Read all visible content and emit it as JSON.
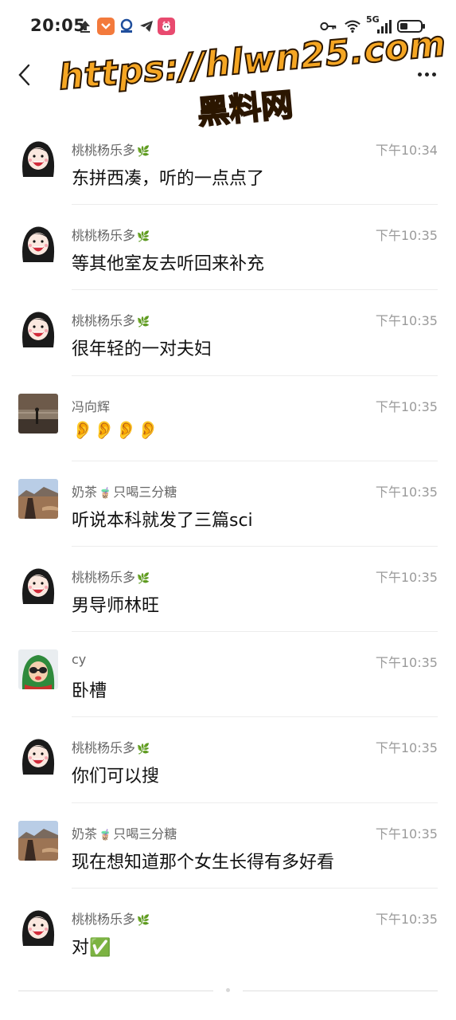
{
  "status_bar": {
    "time": "20:05",
    "network_label": "5G"
  },
  "nav": {
    "back_icon": "chevron-left-icon",
    "more_icon": "more-horizontal-icon"
  },
  "watermark": {
    "line1": "https://hlwn25.com",
    "line2": "黑料网"
  },
  "messages": [
    {
      "name": "桃桃杨乐多",
      "name_emoji": "🌿",
      "time": "下午10:34",
      "text": "东拼西凑，听的一点点了",
      "avatar": "cartoon-girl"
    },
    {
      "name": "桃桃杨乐多",
      "name_emoji": "🌿",
      "time": "下午10:35",
      "text": "等其他室友去听回来补充",
      "avatar": "cartoon-girl"
    },
    {
      "name": "桃桃杨乐多",
      "name_emoji": "🌿",
      "time": "下午10:35",
      "text": "很年轻的一对夫妇",
      "avatar": "cartoon-girl"
    },
    {
      "name": "冯向辉",
      "name_emoji": "",
      "time": "下午10:35",
      "text": "👂👂👂👂",
      "avatar": "beach-photo"
    },
    {
      "name": "奶茶",
      "name_emoji": "🧋",
      "name_suffix": "只喝三分糖",
      "time": "下午10:35",
      "text": "听说本科就发了三篇sci",
      "avatar": "landscape-photo"
    },
    {
      "name": "桃桃杨乐多",
      "name_emoji": "🌿",
      "time": "下午10:35",
      "text": "男导师林旺",
      "avatar": "cartoon-girl"
    },
    {
      "name": "cy",
      "name_emoji": "",
      "time": "下午10:35",
      "text": "卧槽",
      "avatar": "green-hood-kid"
    },
    {
      "name": "桃桃杨乐多",
      "name_emoji": "🌿",
      "time": "下午10:35",
      "text": "你们可以搜",
      "avatar": "cartoon-girl"
    },
    {
      "name": "奶茶",
      "name_emoji": "🧋",
      "name_suffix": "只喝三分糖",
      "time": "下午10:35",
      "text": "现在想知道那个女生长得有多好看",
      "avatar": "landscape-photo"
    },
    {
      "name": "桃桃杨乐多",
      "name_emoji": "🌿",
      "time": "下午10:35",
      "text": "对✅",
      "avatar": "cartoon-girl"
    }
  ]
}
